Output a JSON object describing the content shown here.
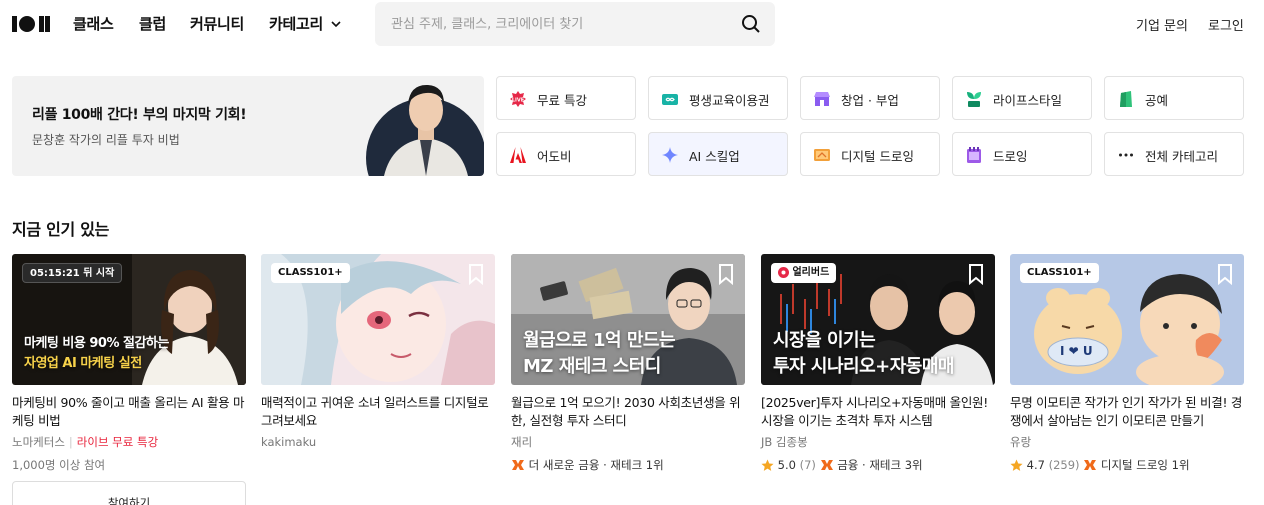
{
  "header": {
    "nav": [
      "클래스",
      "클럽",
      "커뮤니티",
      "카테고리"
    ],
    "search_placeholder": "관심 주제, 클래스, 크리에이터 찾기",
    "links": [
      "기업 문의",
      "로그인"
    ]
  },
  "banner": {
    "title": "리플 100배 간다! 부의 마지막 기회!",
    "subtitle": "문창훈 작가의 리플 투자 비법"
  },
  "categories": [
    {
      "label": "무료 특강",
      "icon": "free-lecture-icon"
    },
    {
      "label": "평생교육이용권",
      "icon": "voucher-icon"
    },
    {
      "label": "창업 · 부업",
      "icon": "shop-icon"
    },
    {
      "label": "라이프스타일",
      "icon": "sprout-icon"
    },
    {
      "label": "공예",
      "icon": "craft-icon"
    },
    {
      "label": "어도비",
      "icon": "adobe-icon"
    },
    {
      "label": "AI 스킬업",
      "icon": "sparkle-icon"
    },
    {
      "label": "디지털 드로잉",
      "icon": "tablet-icon"
    },
    {
      "label": "드로잉",
      "icon": "sketchbook-icon"
    },
    {
      "label": "전체 카테고리",
      "icon": "more-icon"
    }
  ],
  "section_title": "지금 인기 있는",
  "cards": [
    {
      "badge": "05:15:21 뒤 시작",
      "overlay_lines": [
        "마케팅 비용 90% 절감하는",
        "자영업 AI 마케팅 실전"
      ],
      "title": "마케팅비 90% 줄이고 매출 올리는 AI 활용 마케팅 비법",
      "author": "노마케터스",
      "tag": "라이브 무료 특강",
      "stats": "1,000명 이상 참여",
      "button": "참여하기"
    },
    {
      "badge": "CLASS101+",
      "title": "매력적이고 귀여운 소녀 일러스트를 디지털로 그려보세요",
      "author": "kakimaku"
    },
    {
      "overlay_lines": [
        "월급으로 1억 만드는",
        "MZ 재테크 스터디"
      ],
      "title": "월급으로 1억 모으기! 2030 사회초년생을 위한, 실전형 투자 스터디",
      "author": "재리",
      "rank": "더 새로운 금융 · 재테크 1위"
    },
    {
      "badge": "얼리버드",
      "overlay_lines": [
        "시장을 이기는",
        "투자 시나리오+자동매매"
      ],
      "title": "[2025ver]투자 시나리오+자동매매 올인원! 시장을 이기는 초격차 투자 시스템",
      "author": "JB 김종봉",
      "rating": "5.0",
      "reviews": "(7)",
      "rank": "금융 · 재테크 3위"
    },
    {
      "badge": "CLASS101+",
      "title": "무명 이모티콘 작가가 인기 작가가 된 비결! 경쟁에서 살아남는 인기 이모티콘 만들기",
      "author": "유랑",
      "rating": "4.7",
      "reviews": "(259)",
      "rank": "디지털 드로잉 1위",
      "sticker_text": "I ❤ U"
    }
  ]
}
